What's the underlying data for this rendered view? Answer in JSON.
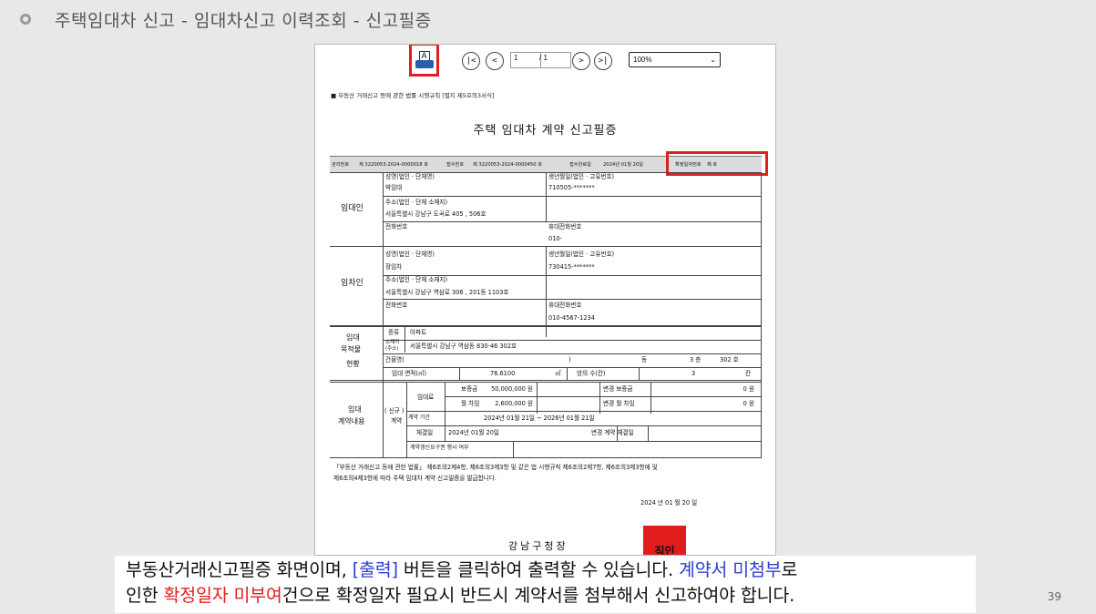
{
  "slide": {
    "title": "주택임대차 신고 - 임대차신고 이력조회 - 신고필증",
    "page_number": "39"
  },
  "toolbar": {
    "print_label": "A",
    "first": "|<",
    "prev": "<",
    "page_input": "1",
    "page_total": "/ 1",
    "next": ">",
    "last": ">|",
    "zoom": "100%"
  },
  "doc": {
    "reference": "■ 부동산 거래신고 등에 관한 법률 시행규칙 [별지 제5호의3서식]",
    "title": "주택 임대차 계약 신고필증",
    "header": {
      "mgmt_label": "관리번호",
      "mgmt_value": "제 3220053-2024-0000018 호",
      "recv_label": "접수번호",
      "recv_value": "제 3220053-2024-0000450 호",
      "date_label": "접수완료일",
      "date_value": "2024년 01월 20일",
      "fix_label": "확정일자번호",
      "fix_value": "제              호"
    },
    "lessor": {
      "section": "임대인",
      "name_label": "성명(법인 · 단체명)",
      "name": "박임대",
      "birth_label": "생년월일(법인 · 고유번호)",
      "birth": "710505-*******",
      "addr_label": "주소(법인 · 단체 소재지)",
      "addr": "서울특별시 강남구 도곡로 405 , 506호",
      "phone_label": "전화번호",
      "mobile_label": "휴대전화번호",
      "mobile": "010-"
    },
    "lessee": {
      "section": "임차인",
      "name_label": "성명(법인 · 단체명)",
      "name": "장임차",
      "birth_label": "생년월일(법인 · 고유번호)",
      "birth": "730415-*******",
      "addr_label": "주소(법인 · 단체 소재지)",
      "addr": "서울특별시 강남구 역삼로 306 , 201동 1103호",
      "phone_label": "전화번호",
      "mobile_label": "휴대전화번호",
      "mobile": "010-4567-1234"
    },
    "property": {
      "section_1": "임대",
      "section_2": "목적물",
      "section_3": "현황",
      "type_label": "종류",
      "type": "아파트",
      "loc_label_1": "소재지",
      "loc_label_2": "(주소)",
      "loc": "서울특별시 강남구 역삼동 830-46 302호",
      "bldg_label": "건물명(",
      "bldg_paren": ")",
      "dong": "동",
      "floor": "3 층",
      "ho": "302 호",
      "area_label": "임대 면적(㎡)",
      "area": "76.6100",
      "area_unit": "㎡",
      "rooms_label": "방의 수(칸)",
      "rooms": "3",
      "rooms_unit": "칸"
    },
    "contract": {
      "section_1": "임대",
      "section_2": "계약내용",
      "kind_1": "( 신규 )",
      "kind_2": "계약",
      "rent_label": "임대료",
      "deposit_label": "보증금",
      "deposit": "50,000,000 원",
      "chg_deposit_label": "변경 보증금",
      "chg_deposit": "0 원",
      "monthly_label": "월 차임",
      "monthly": "2,600,000 원",
      "chg_monthly_label": "변경 월 차임",
      "chg_monthly": "0 원",
      "period_label": "계약 기간",
      "period": "2024년 01월 21일   ~   2026년 01월 21일",
      "sign_label": "체결일",
      "sign": "2024년 01월 20일",
      "chg_sign_label": "변경 계약 체결일",
      "renew_label": "계약갱신요구권 행사 여부"
    },
    "notice_1": "「부동산 거래신고 등에 관한 법률」 제6조의2제4항, 제6조의3제3항 및 같은 법 시행규칙 제6조의2제7항, 제6조의3제3항에 및",
    "notice_2": "제6조의4제3항에 따라 주택 임대차 계약 신고필증을 발급합니다.",
    "issue_date": "2024   년   01   월   20   일",
    "issuer": "강남구청장",
    "seal": "직인"
  },
  "caption": {
    "p1": "부동산거래신고필증 화면이며, ",
    "p2": "[출력]",
    "p3": " 버튼을 클릭하여 출력할 수 있습니다. ",
    "p4": "계약서 미첨부",
    "p5": "로",
    "p6": "인한 ",
    "p7": "확정일자 미부여",
    "p8": "건으로 확정일자 필요시 반드시 계약서를 첨부해서 신고하여야 합니다."
  }
}
